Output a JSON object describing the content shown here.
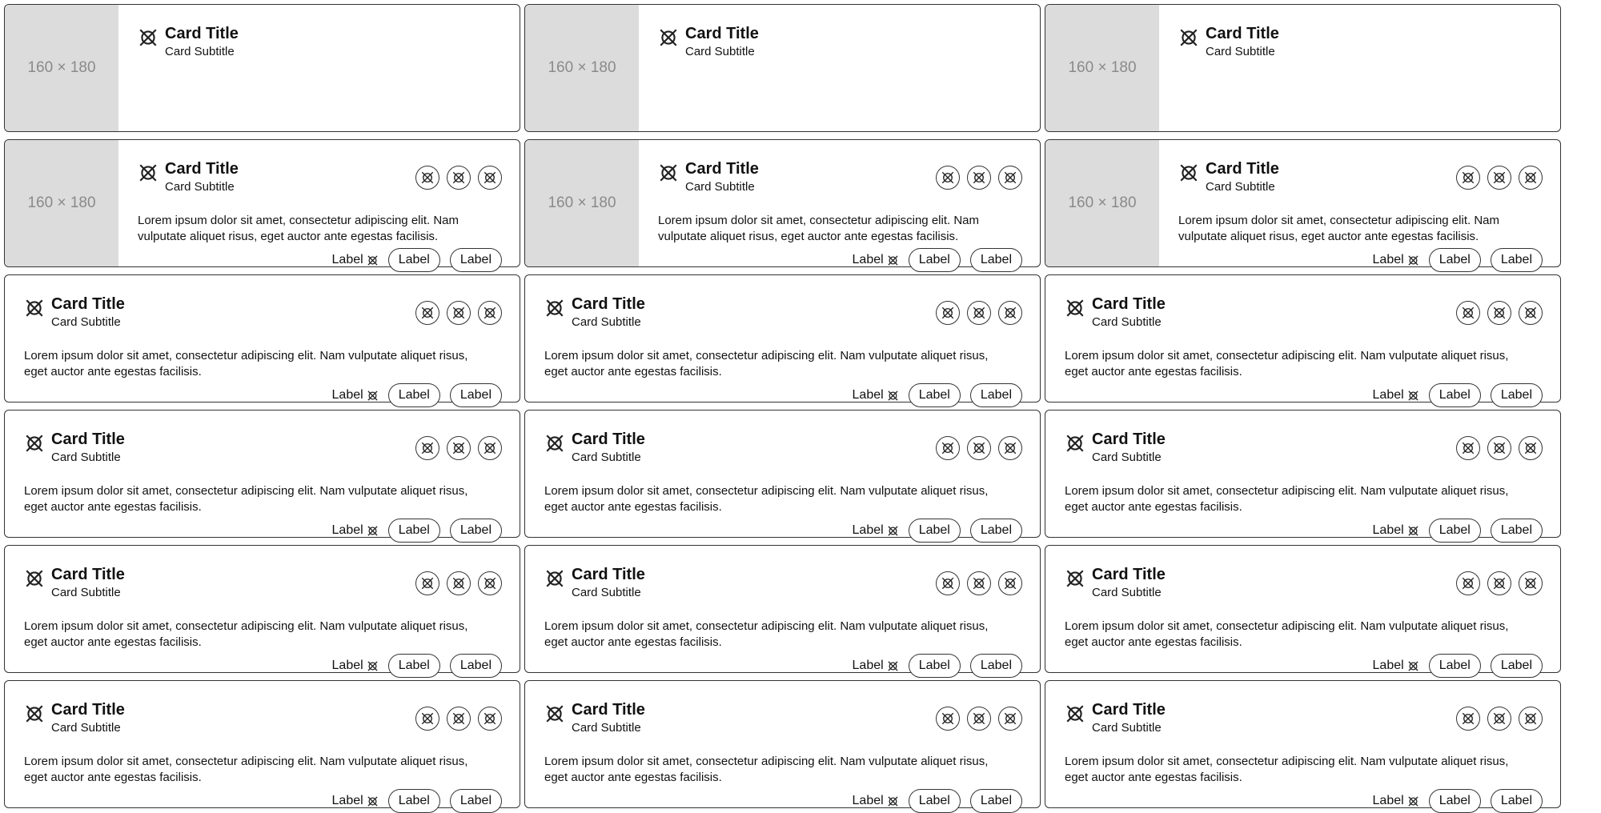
{
  "cards": [
    {
      "variant": "simple",
      "media_label": "160 × 180",
      "title": "Card Title",
      "subtitle": "Card Subtitle"
    },
    {
      "variant": "simple",
      "media_label": "160 × 180",
      "title": "Card Title",
      "subtitle": "Card Subtitle"
    },
    {
      "variant": "simple",
      "media_label": "160 × 180",
      "title": "Card Title",
      "subtitle": "Card Subtitle"
    },
    {
      "variant": "media-full",
      "media_label": "160 × 180",
      "title": "Card Title",
      "subtitle": "Card Subtitle",
      "text": "Lorem ipsum dolor sit amet, consectetur adipiscing elit. Nam vulputate aliquet risus, eget auctor ante egestas facilisis.",
      "text_button": "Label",
      "button_1": "Label",
      "button_2": "Label"
    },
    {
      "variant": "media-full",
      "media_label": "160 × 180",
      "title": "Card Title",
      "subtitle": "Card Subtitle",
      "text": "Lorem ipsum dolor sit amet, consectetur adipiscing elit. Nam vulputate aliquet risus, eget auctor ante egestas facilisis.",
      "text_button": "Label",
      "button_1": "Label",
      "button_2": "Label"
    },
    {
      "variant": "media-full",
      "media_label": "160 × 180",
      "title": "Card Title",
      "subtitle": "Card Subtitle",
      "text": "Lorem ipsum dolor sit amet, consectetur adipiscing elit. Nam vulputate aliquet risus, eget auctor ante egestas facilisis.",
      "text_button": "Label",
      "button_1": "Label",
      "button_2": "Label"
    },
    {
      "variant": "full",
      "title": "Card Title",
      "subtitle": "Card Subtitle",
      "text": "Lorem ipsum dolor sit amet, consectetur adipiscing elit. Nam vulputate aliquet risus, eget auctor ante egestas facilisis.",
      "text_button": "Label",
      "button_1": "Label",
      "button_2": "Label"
    },
    {
      "variant": "full",
      "title": "Card Title",
      "subtitle": "Card Subtitle",
      "text": "Lorem ipsum dolor sit amet, consectetur adipiscing elit. Nam vulputate aliquet risus, eget auctor ante egestas facilisis.",
      "text_button": "Label",
      "button_1": "Label",
      "button_2": "Label"
    },
    {
      "variant": "full",
      "title": "Card Title",
      "subtitle": "Card Subtitle",
      "text": "Lorem ipsum dolor sit amet, consectetur adipiscing elit. Nam vulputate aliquet risus, eget auctor ante egestas facilisis.",
      "text_button": "Label",
      "button_1": "Label",
      "button_2": "Label"
    },
    {
      "variant": "full",
      "title": "Card Title",
      "subtitle": "Card Subtitle",
      "text": "Lorem ipsum dolor sit amet, consectetur adipiscing elit. Nam vulputate aliquet risus, eget auctor ante egestas facilisis.",
      "text_button": "Label",
      "button_1": "Label",
      "button_2": "Label"
    },
    {
      "variant": "full",
      "title": "Card Title",
      "subtitle": "Card Subtitle",
      "text": "Lorem ipsum dolor sit amet, consectetur adipiscing elit. Nam vulputate aliquet risus, eget auctor ante egestas facilisis.",
      "text_button": "Label",
      "button_1": "Label",
      "button_2": "Label"
    },
    {
      "variant": "full",
      "title": "Card Title",
      "subtitle": "Card Subtitle",
      "text": "Lorem ipsum dolor sit amet, consectetur adipiscing elit. Nam vulputate aliquet risus, eget auctor ante egestas facilisis.",
      "text_button": "Label",
      "button_1": "Label",
      "button_2": "Label"
    },
    {
      "variant": "full",
      "title": "Card Title",
      "subtitle": "Card Subtitle",
      "text": "Lorem ipsum dolor sit amet, consectetur adipiscing elit. Nam vulputate aliquet risus, eget auctor ante egestas facilisis.",
      "text_button": "Label",
      "button_1": "Label",
      "button_2": "Label"
    },
    {
      "variant": "full",
      "title": "Card Title",
      "subtitle": "Card Subtitle",
      "text": "Lorem ipsum dolor sit amet, consectetur adipiscing elit. Nam vulputate aliquet risus, eget auctor ante egestas facilisis.",
      "text_button": "Label",
      "button_1": "Label",
      "button_2": "Label"
    },
    {
      "variant": "full",
      "title": "Card Title",
      "subtitle": "Card Subtitle",
      "text": "Lorem ipsum dolor sit amet, consectetur adipiscing elit. Nam vulputate aliquet risus, eget auctor ante egestas facilisis.",
      "text_button": "Label",
      "button_1": "Label",
      "button_2": "Label"
    },
    {
      "variant": "full",
      "title": "Card Title",
      "subtitle": "Card Subtitle",
      "text": "Lorem ipsum dolor sit amet, consectetur adipiscing elit. Nam vulputate aliquet risus, eget auctor ante egestas facilisis.",
      "text_button": "Label",
      "button_1": "Label",
      "button_2": "Label"
    },
    {
      "variant": "full",
      "title": "Card Title",
      "subtitle": "Card Subtitle",
      "text": "Lorem ipsum dolor sit amet, consectetur adipiscing elit. Nam vulputate aliquet risus, eget auctor ante egestas facilisis.",
      "text_button": "Label",
      "button_1": "Label",
      "button_2": "Label"
    },
    {
      "variant": "full",
      "title": "Card Title",
      "subtitle": "Card Subtitle",
      "text": "Lorem ipsum dolor sit amet, consectetur adipiscing elit. Nam vulputate aliquet risus, eget auctor ante egestas facilisis.",
      "text_button": "Label",
      "button_1": "Label",
      "button_2": "Label"
    }
  ],
  "icons": {
    "lead": "placeholder-icon",
    "actions": [
      "placeholder-icon",
      "placeholder-icon",
      "placeholder-icon"
    ],
    "text_button": "placeholder-icon"
  }
}
